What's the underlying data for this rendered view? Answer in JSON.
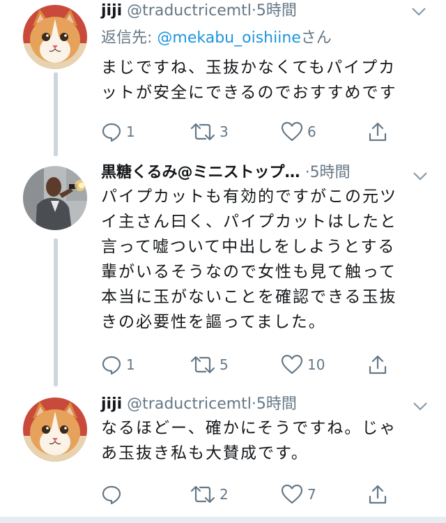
{
  "colors": {
    "accent": "#1b95e0",
    "muted": "#657786",
    "text": "#14171a",
    "thread_line": "#ccd6dd"
  },
  "tweets": [
    {
      "name": "jiji",
      "handle": "@traductricemtl",
      "separator": "·",
      "time": "5時間",
      "avatar": "cat-avatar",
      "reply_to": {
        "prefix": "返信先: ",
        "mention": "@mekabu_oishiine",
        "suffix": "さん"
      },
      "lines": [
        "まじですね、玉抜かなくてもパイプカ",
        "ットが安全にできるのでおすすめです"
      ],
      "actions": {
        "replies": "1",
        "retweets": "3",
        "likes": "6"
      }
    },
    {
      "name": "黒糖くるみ@ミニストップ…",
      "handle": "",
      "separator": "·",
      "time": "5時間",
      "avatar": "man-with-gun-avatar",
      "lines": [
        "パイプカットも有効的ですがこの元ツ",
        "イ主さん曰く、パイプカットはしたと",
        "言って嘘ついて中出しをしようとする",
        "輩がいるそうなので女性も見て触って",
        "本当に玉がないことを確認できる玉抜",
        "きの必要性を謳ってました。"
      ],
      "actions": {
        "replies": "1",
        "retweets": "5",
        "likes": "10"
      }
    },
    {
      "name": "jiji",
      "handle": "@traductricemtl",
      "separator": "·",
      "time": "5時間",
      "avatar": "cat-avatar",
      "lines": [
        "なるほどー、確かにそうですね。じゃ",
        "あ玉抜き私も大賛成です。"
      ],
      "actions": {
        "replies": "",
        "retweets": "2",
        "likes": "7"
      }
    }
  ]
}
